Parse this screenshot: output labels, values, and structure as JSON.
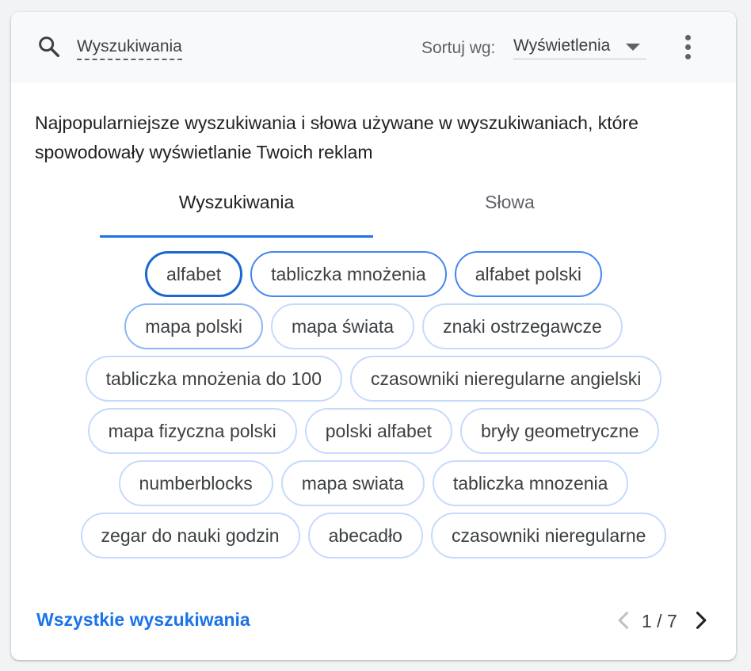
{
  "toolbar": {
    "search_label": "Wyszukiwania",
    "sort_label": "Sortuj wg:",
    "sort_value": "Wyświetlenia",
    "icons": {
      "search": "search-icon",
      "sort": "chevron-down-icon",
      "more": "more-vert-icon"
    }
  },
  "description": "Najpopularniejsze wyszukiwania i słowa używane w wyszukiwaniach, które spowodowały wyświetlanie Twoich reklam",
  "tabs": [
    {
      "label": "Wyszukiwania",
      "active": true
    },
    {
      "label": "Słowa",
      "active": false
    }
  ],
  "chip_rows": [
    [
      {
        "label": "alfabet",
        "weight": 4
      },
      {
        "label": "tabliczka mnożenia",
        "weight": 3
      },
      {
        "label": "alfabet polski",
        "weight": 3
      }
    ],
    [
      {
        "label": "mapa polski",
        "weight": 2
      },
      {
        "label": "mapa świata",
        "weight": 1
      },
      {
        "label": "znaki ostrzegawcze",
        "weight": 1
      }
    ],
    [
      {
        "label": "tabliczka mnożenia do 100",
        "weight": 1
      },
      {
        "label": "czasowniki nieregularne angielski",
        "weight": 1
      }
    ],
    [
      {
        "label": "mapa fizyczna polski",
        "weight": 1
      },
      {
        "label": "polski alfabet",
        "weight": 1
      },
      {
        "label": "bryły geometryczne",
        "weight": 1
      }
    ],
    [
      {
        "label": "numberblocks",
        "weight": 1
      },
      {
        "label": "mapa swiata",
        "weight": 1
      },
      {
        "label": "tabliczka mnozenia",
        "weight": 1
      }
    ],
    [
      {
        "label": "zegar do nauki godzin",
        "weight": 1
      },
      {
        "label": "abecadło",
        "weight": 1
      },
      {
        "label": "czasowniki nieregularne",
        "weight": 1
      }
    ]
  ],
  "footer": {
    "link": "Wszystkie wyszukiwania",
    "pager": "1 / 7"
  },
  "colors": {
    "accent": "#1a73e8",
    "chip_border_light": "#c6dafc",
    "chip_border_strong": "#1967d2"
  }
}
